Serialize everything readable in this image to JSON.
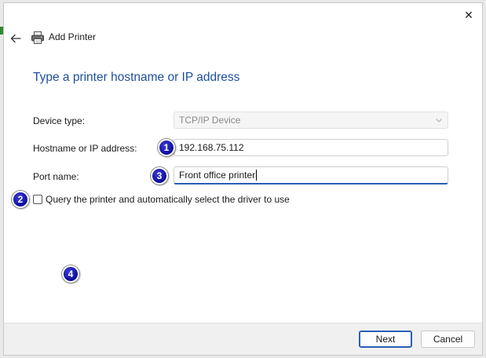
{
  "window": {
    "title": "Add Printer",
    "close_glyph": "✕",
    "back_glyph": "←"
  },
  "page": {
    "heading": "Type a printer hostname or IP address"
  },
  "form": {
    "device_type": {
      "label": "Device type:",
      "value": "TCP/IP Device"
    },
    "hostname": {
      "label": "Hostname or IP address:",
      "value": "192.168.75.112"
    },
    "port_name": {
      "label": "Port name:",
      "value": "Front office printer"
    },
    "query_checkbox": {
      "label": "Query the printer and automatically select the driver to use",
      "checked": false
    }
  },
  "badges": [
    "1",
    "2",
    "3",
    "4"
  ],
  "footer": {
    "next_label": "Next",
    "cancel_label": "Cancel"
  },
  "colors": {
    "heading": "#1f4e9c",
    "accent": "#2a5eb5",
    "badge": "#1010b0"
  },
  "icons": {
    "close": "close-icon",
    "back": "back-arrow-icon",
    "printer": "printer-icon",
    "dropdown": "chevron-down-icon"
  }
}
